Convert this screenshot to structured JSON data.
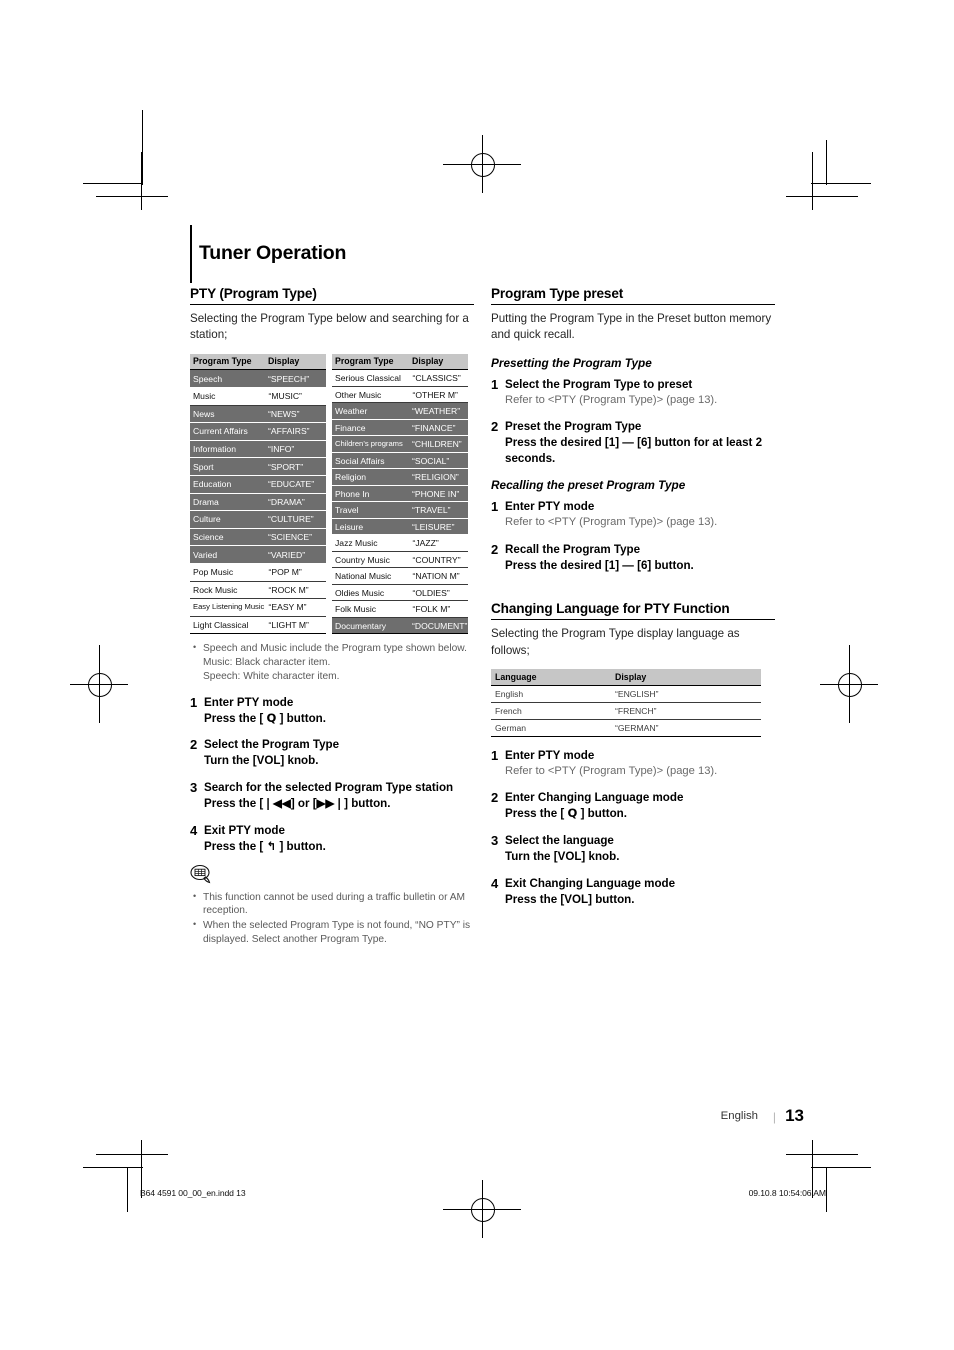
{
  "page_title": "Tuner Operation",
  "left_column": {
    "section": {
      "heading": "PTY (Program Type)",
      "intro": "Selecting the Program Type below and searching for a station;"
    },
    "table": {
      "headers": [
        "Program Type",
        "Display"
      ],
      "left_rows": [
        {
          "type": "Speech",
          "display": "“SPEECH”",
          "shade": "dark"
        },
        {
          "type": "Music",
          "display": "“MUSIC”",
          "shade": "light"
        },
        {
          "type": "News",
          "display": "“NEWS”",
          "shade": "dark"
        },
        {
          "type": "Current Affairs",
          "display": "“AFFAIRS”",
          "shade": "dark"
        },
        {
          "type": "Information",
          "display": "“INFO”",
          "shade": "dark"
        },
        {
          "type": "Sport",
          "display": "“SPORT”",
          "shade": "dark"
        },
        {
          "type": "Education",
          "display": "“EDUCATE”",
          "shade": "dark"
        },
        {
          "type": "Drama",
          "display": "“DRAMA”",
          "shade": "dark"
        },
        {
          "type": "Culture",
          "display": "“CULTURE”",
          "shade": "dark"
        },
        {
          "type": "Science",
          "display": "“SCIENCE”",
          "shade": "dark"
        },
        {
          "type": "Varied",
          "display": "“VARIED”",
          "shade": "dark"
        },
        {
          "type": "Pop Music",
          "display": "“POP M”",
          "shade": "light"
        },
        {
          "type": "Rock Music",
          "display": "“ROCK M”",
          "shade": "light"
        },
        {
          "type": "Easy Listening Music",
          "display": "“EASY M”",
          "shade": "light"
        },
        {
          "type": "Light Classical",
          "display": "“LIGHT M”",
          "shade": "light"
        }
      ],
      "right_rows": [
        {
          "type": "Serious Classical",
          "display": "“CLASSICS”",
          "shade": "light"
        },
        {
          "type": "Other Music",
          "display": "“OTHER M”",
          "shade": "light"
        },
        {
          "type": "Weather",
          "display": "“WEATHER”",
          "shade": "dark"
        },
        {
          "type": "Finance",
          "display": "“FINANCE”",
          "shade": "dark"
        },
        {
          "type": "Children’s programs",
          "display": "“CHILDREN”",
          "shade": "dark"
        },
        {
          "type": "Social Affairs",
          "display": "“SOCIAL”",
          "shade": "dark"
        },
        {
          "type": "Religion",
          "display": "“RELIGION”",
          "shade": "dark"
        },
        {
          "type": "Phone In",
          "display": "“PHONE IN”",
          "shade": "dark"
        },
        {
          "type": "Travel",
          "display": "“TRAVEL”",
          "shade": "dark"
        },
        {
          "type": "Leisure",
          "display": "“LEISURE”",
          "shade": "dark"
        },
        {
          "type": "Jazz Music",
          "display": "“JAZZ”",
          "shade": "light"
        },
        {
          "type": "Country Music",
          "display": "“COUNTRY”",
          "shade": "light"
        },
        {
          "type": "National Music",
          "display": "“NATION M”",
          "shade": "light"
        },
        {
          "type": "Oldies Music",
          "display": "“OLDIES”",
          "shade": "light"
        },
        {
          "type": "Folk Music",
          "display": "“FOLK M”",
          "shade": "light"
        },
        {
          "type": "Documentary",
          "display": "“DOCUMENT”",
          "shade": "dark"
        }
      ]
    },
    "table_notes": [
      "Speech and Music include the Program type shown below.",
      "Music: Black character item.",
      "Speech: White character item."
    ],
    "steps": [
      {
        "num": "1",
        "title": "Enter PTY mode",
        "action_pre": "Press the [ ",
        "action_glyph": "Q",
        "action_post": " ] button."
      },
      {
        "num": "2",
        "title": "Select the Program Type",
        "action": "Turn the [VOL] knob."
      },
      {
        "num": "3",
        "title": "Search for the selected Program Type station",
        "action": "Press the [❘◀◀] or [▶▶❘] button."
      },
      {
        "num": "4",
        "title": "Exit PTY mode",
        "action_pre": "Press  the [ ",
        "action_glyph": "↰",
        "action_post": " ]  button."
      }
    ],
    "bottom_notes": [
      "This function cannot be used during a traffic bulletin or AM reception.",
      "When the selected Program Type is not found, “NO PTY” is displayed. Select another Program Type."
    ]
  },
  "right_column": {
    "preset_section": {
      "heading": "Program Type preset",
      "intro": "Putting the Program Type in the Preset button memory and quick recall.",
      "sub1": "Presetting the Program Type",
      "steps1": [
        {
          "num": "1",
          "title": "Select the Program Type to preset",
          "action_gray": "Refer to <PTY (Program Type)> (page 13)."
        },
        {
          "num": "2",
          "title": "Preset the Program Type",
          "action": "Press the desired [1] — [6] button for at least 2 seconds."
        }
      ],
      "sub2": "Recalling the preset Program Type",
      "steps2": [
        {
          "num": "1",
          "title": "Enter PTY mode",
          "action_gray": "Refer to <PTY (Program Type)> (page 13)."
        },
        {
          "num": "2",
          "title": "Recall the Program Type",
          "action": "Press the desired [1] — [6] button."
        }
      ]
    },
    "language_section": {
      "heading": "Changing Language for PTY Function",
      "intro": "Selecting the Program Type display language as follows;",
      "table": {
        "headers": [
          "Language",
          "Display"
        ],
        "rows": [
          {
            "language": "English",
            "display": "“ENGLISH”"
          },
          {
            "language": "French",
            "display": "“FRENCH”"
          },
          {
            "language": "German",
            "display": "“GERMAN”"
          }
        ]
      },
      "steps": [
        {
          "num": "1",
          "title": "Enter PTY mode",
          "action_gray": "Refer to <PTY (Program Type)> (page 13)."
        },
        {
          "num": "2",
          "title": "Enter Changing Language mode",
          "action_pre": "Press the [ ",
          "action_glyph": "Q",
          "action_post": " ] button."
        },
        {
          "num": "3",
          "title": "Select the language",
          "action": "Turn the [VOL] knob."
        },
        {
          "num": "4",
          "title": "Exit Changing Language mode",
          "action": "Press the [VOL] button."
        }
      ]
    }
  },
  "footer": {
    "language": "English",
    "separator": "|",
    "page_number": "13",
    "file_meta": "B64 4591 00_00_en.indd   13",
    "timestamp_meta": "09.10.8   10:54:06 AM"
  }
}
